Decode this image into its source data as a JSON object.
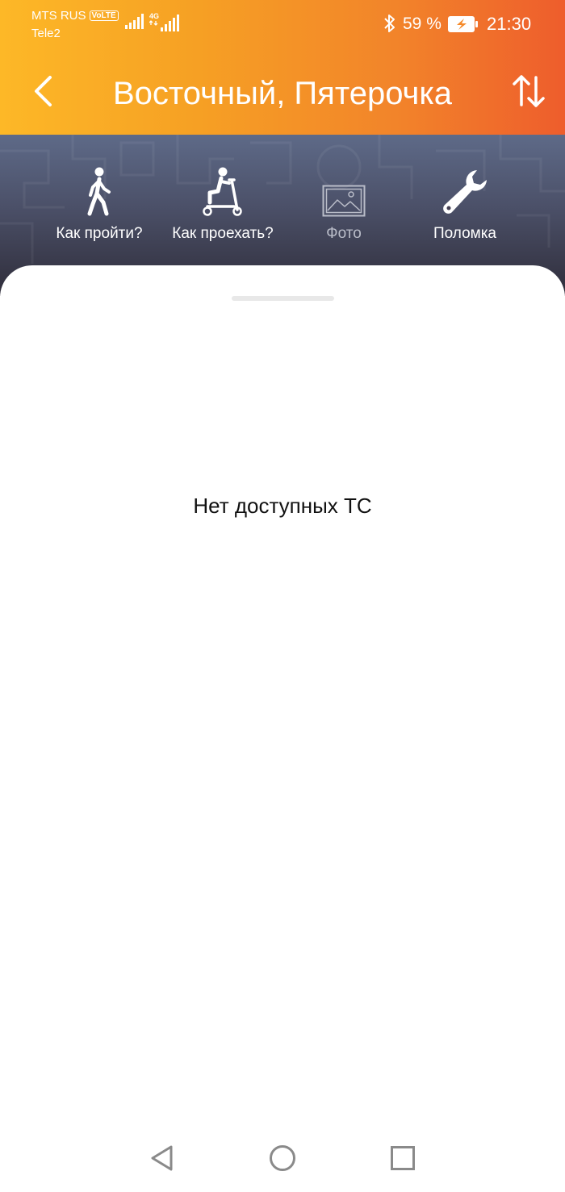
{
  "status_bar": {
    "carrier_1": "MTS RUS",
    "volte": "VoLTE",
    "carrier_2": "Tele2",
    "network": "4G",
    "battery": "59 %",
    "time": "21:30"
  },
  "header": {
    "title": "Восточный, Пятерочка",
    "back_icon": "chevron-left-icon",
    "swap_icon": "swap-vertical-icon",
    "gradient_start": "#fdb827",
    "gradient_end": "#ee5d2c"
  },
  "actions": [
    {
      "label": "Как пройти?",
      "icon": "walking-person-icon",
      "enabled": true
    },
    {
      "label": "Как проехать?",
      "icon": "scooter-icon",
      "enabled": true
    },
    {
      "label": "Фото",
      "icon": "photo-icon",
      "enabled": false
    },
    {
      "label": "Поломка",
      "icon": "wrench-icon",
      "enabled": true
    }
  ],
  "sheet": {
    "empty_message": "Нет доступных ТС"
  },
  "nav_bar": {
    "back": "triangle-back-icon",
    "home": "circle-home-icon",
    "recents": "square-recents-icon"
  }
}
